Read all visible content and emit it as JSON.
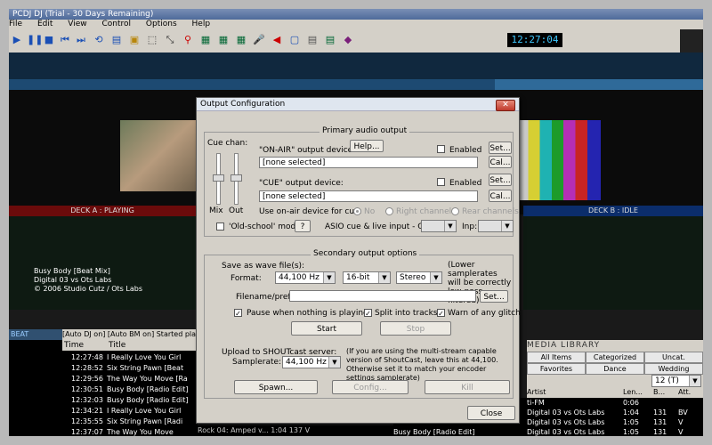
{
  "app": {
    "title": "PCDJ DJ (Trial - 30 Days Remaining)",
    "menu": [
      "File",
      "Edit",
      "View",
      "Control",
      "Options",
      "Help"
    ],
    "clock": "12:27:04",
    "deck_a_label": "DECK A : PLAYING",
    "deck_b_label": "DECK B : IDLE",
    "track_title": "Busy Body [Beat Mix]",
    "track_artist": "Digital 03 vs Ots Labs",
    "track_copyright": "© 2006 Studio Cutz / Ots Labs",
    "beat_label": "BEAT",
    "auto_bar": "[Auto DJ on] [Auto BM on] Started play",
    "playlist_headers": [
      "Time",
      "Title"
    ],
    "playlist_rows": [
      {
        "time": "12:27:48",
        "title": "I Really Love You Girl"
      },
      {
        "time": "12:28:52",
        "title": "Six String Pawn [Beat"
      },
      {
        "time": "12:29:56",
        "title": "The Way You Move [Ra"
      },
      {
        "time": "12:30:51",
        "title": "Busy Body [Radio Edit]"
      },
      {
        "time": "12:32:03",
        "title": "Busy Body [Radio Edit]"
      },
      {
        "time": "12:34:21",
        "title": "I Really Love You Girl"
      },
      {
        "time": "12:35:55",
        "title": "Six String Pawn [Radi"
      },
      {
        "time": "12:37:07",
        "title": "The Way You Move"
      }
    ],
    "bottom_row": "Rock 04: Amped v...   1:04   137   V",
    "media_library_title": "MEDIA LIBRARY",
    "media_tabs": [
      "All Items",
      "Categorized",
      "Uncat.",
      "Favorites",
      "Dance",
      "Wedding"
    ],
    "media_headers": [
      "Artist",
      "Len...",
      "B...",
      "Att."
    ],
    "media_rows": [
      {
        "title": "",
        "artist": "ti-FM",
        "len": "0:06",
        "bpm": "",
        "att": ""
      },
      {
        "title": "",
        "artist": "Digital 03 vs Ots Labs",
        "len": "1:04",
        "bpm": "131",
        "att": "BV"
      },
      {
        "title": "",
        "artist": "Digital 03 vs Ots Labs",
        "len": "1:05",
        "bpm": "131",
        "att": "V"
      },
      {
        "title": "Busy Body [Radio Edit]",
        "artist": "Digital 03 vs Ots Labs",
        "len": "1:05",
        "bpm": "131",
        "att": "V"
      }
    ],
    "media_select_value": "12 (T)"
  },
  "dialog": {
    "title": "Output Configuration",
    "primary": {
      "group_label": "Primary audio output",
      "cue_chan_label": "Cue chan:",
      "mix_label": "Mix",
      "out_label": "Out",
      "on_air_label": "\"ON-AIR\" output device:",
      "help_label": "Help...",
      "on_air_enabled_label": "Enabled",
      "on_air_set_label": "Set...",
      "on_air_value": "[none selected]",
      "on_air_cal_label": "Cal...",
      "cue_label": "\"CUE\" output device:",
      "cue_enabled_label": "Enabled",
      "cue_set_label": "Set...",
      "cue_value": "[none selected]",
      "cue_cal_label": "Cal...",
      "use_on_air_label": "Use on-air device for cue:",
      "radio_no": "No",
      "radio_right": "Right channel",
      "radio_rear": "Rear channels",
      "oldschool_label": "'Old-school' mode",
      "question_label": "?",
      "asio_label": "ASIO cue & live input - Cue:",
      "inp_label": "Inp:"
    },
    "secondary": {
      "group_label": "Secondary output options",
      "save_wave_label": "Save as wave file(s):",
      "format_label": "Format:",
      "format_rate": "44,100 Hz",
      "format_bits": "16-bit",
      "format_channels": "Stereo",
      "lower_rates_note": "(Lower samplerates will be correctly low-pass filtered)",
      "filename_label": "Filename/prefix:",
      "filename_value": "",
      "filename_set_label": "Set...",
      "pause_label": "Pause when nothing is playing",
      "split_label": "Split into tracks",
      "warn_label": "Warn of any glitch",
      "start_label": "Start",
      "stop_label": "Stop",
      "upload_label": "Upload to SHOUTcast server:",
      "samplerate_label": "Samplerate:",
      "samplerate_value": "44,100 Hz",
      "multistream_note": "(If you are using the multi-stream capable version of ShoutCast, leave this at 44,100. Otherwise set it to match your encoder settings samplerate)",
      "spawn_label": "Spawn...",
      "config_label": "Config...",
      "kill_label": "Kill"
    },
    "close_label": "Close"
  }
}
